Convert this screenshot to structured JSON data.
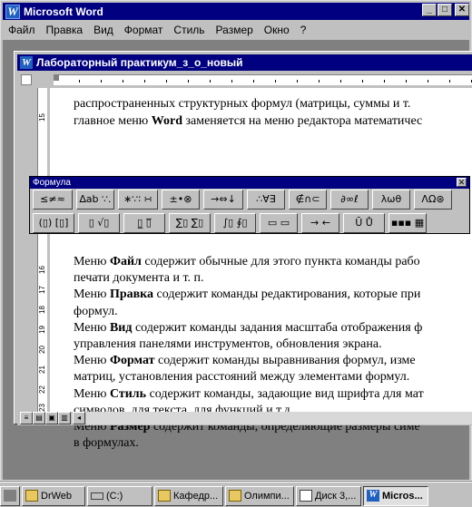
{
  "app": {
    "title": "Microsoft Word",
    "icon": "word-icon",
    "controls": [
      "minimize",
      "maximize",
      "close"
    ]
  },
  "menu": [
    "Файл",
    "Правка",
    "Вид",
    "Формат",
    "Стиль",
    "Размер",
    "Окно",
    "?"
  ],
  "document": {
    "title": "Лабораторный практикум_з_о_новый",
    "vruler_numbers": [
      "15",
      "16",
      "17",
      "18",
      "19",
      "20",
      "21",
      "22",
      "23"
    ],
    "top_lines": [
      "распространенных структурных формул (матрицы, суммы и т.",
      "главное меню Word заменяется на меню редактора математичес"
    ],
    "paragraphs": [
      {
        "bold": "Файл",
        "pre": "Меню ",
        "post": " содержит обычные для этого пункта команды рабо"
      },
      {
        "pre": "печати документа и т. п.",
        "bold": "",
        "post": ""
      },
      {
        "bold": "Правка",
        "pre": "Меню ",
        "post": " содержит команды редактирования, которые при"
      },
      {
        "pre": "формул.",
        "bold": "",
        "post": ""
      },
      {
        "bold": "Вид",
        "pre": "Меню ",
        "post": " содержит команды задания масштаба отображения ф"
      },
      {
        "pre": "управления панелями инструментов, обновления экрана.",
        "bold": "",
        "post": ""
      },
      {
        "bold": "Формат",
        "pre": " Меню ",
        "post": " содержит команды выравнивания формул, изме"
      },
      {
        "pre": "матриц, установления расстояний между элементами формул.",
        "bold": "",
        "post": ""
      },
      {
        "bold": "Стиль",
        "pre": "Меню ",
        "post": " содержит команды, задающие вид шрифта для мат"
      },
      {
        "pre": "символов, для текста, для функций и т.д.",
        "bold": "",
        "post": ""
      },
      {
        "bold": "Размер",
        "pre": "Меню ",
        "post": " содержит команды, определяющие размеры симе"
      },
      {
        "pre": "в формулах.",
        "bold": "",
        "post": ""
      }
    ]
  },
  "formula_toolbar": {
    "title": "Формула",
    "row1": [
      "≤≠≈",
      "∆ab ∵.",
      "∗∵∶ ∺",
      "±•⊗",
      "→⇔↓",
      "∴∀∃",
      "∉∩⊂",
      "∂∞ℓ",
      "λωθ",
      "ΛΩ⊛"
    ],
    "row2": [
      "(▯) [▯]",
      "▯ √▯",
      "▯̲ ▯̅",
      "∑▯ ∑▯",
      "∫▯ ∮▯",
      "▭ ▭",
      "→ ←",
      "Ū Ů",
      "▪▪▪ ▦"
    ]
  },
  "taskbar": {
    "items": [
      {
        "label": "",
        "icon": "program-icon"
      },
      {
        "label": "DrWeb",
        "icon": "folder-icon"
      },
      {
        "label": "(C:)",
        "icon": "drive-icon"
      },
      {
        "label": "Кафедр...",
        "icon": "folder-icon"
      },
      {
        "label": "Олимпи...",
        "icon": "folder-icon"
      },
      {
        "label": "Диск 3,...",
        "icon": "document-icon"
      },
      {
        "label": "Micros...",
        "icon": "word-icon",
        "active": true
      }
    ]
  }
}
